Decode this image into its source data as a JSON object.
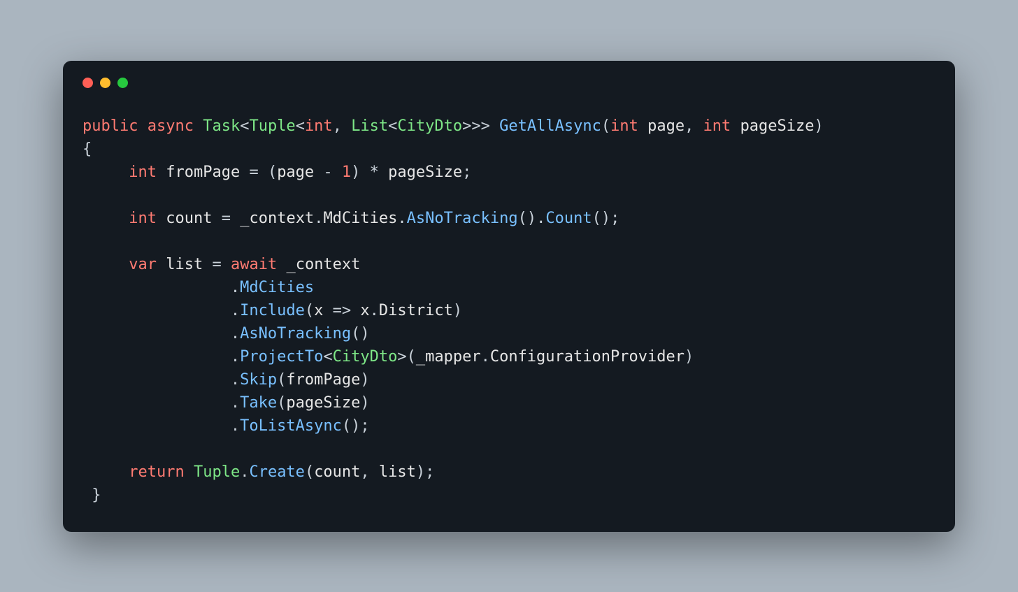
{
  "window": {
    "buttons": [
      "close",
      "minimize",
      "maximize"
    ]
  },
  "code": {
    "tokens": [
      [
        {
          "c": "kw",
          "t": "public"
        },
        {
          "c": "punct",
          "t": " "
        },
        {
          "c": "kw",
          "t": "async"
        },
        {
          "c": "punct",
          "t": " "
        },
        {
          "c": "type",
          "t": "Task"
        },
        {
          "c": "punct",
          "t": "<"
        },
        {
          "c": "type",
          "t": "Tuple"
        },
        {
          "c": "punct",
          "t": "<"
        },
        {
          "c": "kw",
          "t": "int"
        },
        {
          "c": "punct",
          "t": ", "
        },
        {
          "c": "type",
          "t": "List"
        },
        {
          "c": "punct",
          "t": "<"
        },
        {
          "c": "type",
          "t": "CityDto"
        },
        {
          "c": "punct",
          "t": ">>> "
        },
        {
          "c": "method",
          "t": "GetAllAsync"
        },
        {
          "c": "punct",
          "t": "("
        },
        {
          "c": "kw",
          "t": "int"
        },
        {
          "c": "punct",
          "t": " "
        },
        {
          "c": "ident",
          "t": "page"
        },
        {
          "c": "punct",
          "t": ", "
        },
        {
          "c": "kw",
          "t": "int"
        },
        {
          "c": "punct",
          "t": " "
        },
        {
          "c": "ident",
          "t": "pageSize"
        },
        {
          "c": "punct",
          "t": ")"
        }
      ],
      [
        {
          "c": "punct",
          "t": "{"
        }
      ],
      [
        {
          "c": "punct",
          "t": "     "
        },
        {
          "c": "kw",
          "t": "int"
        },
        {
          "c": "punct",
          "t": " "
        },
        {
          "c": "ident",
          "t": "fromPage"
        },
        {
          "c": "punct",
          "t": " = ("
        },
        {
          "c": "ident",
          "t": "page"
        },
        {
          "c": "punct",
          "t": " - "
        },
        {
          "c": "num",
          "t": "1"
        },
        {
          "c": "punct",
          "t": ") * "
        },
        {
          "c": "ident",
          "t": "pageSize"
        },
        {
          "c": "punct",
          "t": ";"
        }
      ],
      [
        {
          "c": "punct",
          "t": ""
        }
      ],
      [
        {
          "c": "punct",
          "t": "     "
        },
        {
          "c": "kw",
          "t": "int"
        },
        {
          "c": "punct",
          "t": " "
        },
        {
          "c": "ident",
          "t": "count"
        },
        {
          "c": "punct",
          "t": " = "
        },
        {
          "c": "ident",
          "t": "_context"
        },
        {
          "c": "punct",
          "t": "."
        },
        {
          "c": "ident",
          "t": "MdCities"
        },
        {
          "c": "punct",
          "t": "."
        },
        {
          "c": "method",
          "t": "AsNoTracking"
        },
        {
          "c": "punct",
          "t": "()."
        },
        {
          "c": "method",
          "t": "Count"
        },
        {
          "c": "punct",
          "t": "();"
        }
      ],
      [
        {
          "c": "punct",
          "t": ""
        }
      ],
      [
        {
          "c": "punct",
          "t": "     "
        },
        {
          "c": "kw",
          "t": "var"
        },
        {
          "c": "punct",
          "t": " "
        },
        {
          "c": "ident",
          "t": "list"
        },
        {
          "c": "punct",
          "t": " = "
        },
        {
          "c": "kw",
          "t": "await"
        },
        {
          "c": "punct",
          "t": " "
        },
        {
          "c": "ident",
          "t": "_context"
        }
      ],
      [
        {
          "c": "punct",
          "t": "                ."
        },
        {
          "c": "method",
          "t": "MdCities"
        }
      ],
      [
        {
          "c": "punct",
          "t": "                ."
        },
        {
          "c": "method",
          "t": "Include"
        },
        {
          "c": "punct",
          "t": "("
        },
        {
          "c": "ident",
          "t": "x"
        },
        {
          "c": "punct",
          "t": " => "
        },
        {
          "c": "ident",
          "t": "x"
        },
        {
          "c": "punct",
          "t": "."
        },
        {
          "c": "ident",
          "t": "District"
        },
        {
          "c": "punct",
          "t": ")"
        }
      ],
      [
        {
          "c": "punct",
          "t": "                ."
        },
        {
          "c": "method",
          "t": "AsNoTracking"
        },
        {
          "c": "punct",
          "t": "()"
        }
      ],
      [
        {
          "c": "punct",
          "t": "                ."
        },
        {
          "c": "method",
          "t": "ProjectTo"
        },
        {
          "c": "punct",
          "t": "<"
        },
        {
          "c": "type",
          "t": "CityDto"
        },
        {
          "c": "punct",
          "t": ">("
        },
        {
          "c": "ident",
          "t": "_mapper"
        },
        {
          "c": "punct",
          "t": "."
        },
        {
          "c": "ident",
          "t": "ConfigurationProvider"
        },
        {
          "c": "punct",
          "t": ")"
        }
      ],
      [
        {
          "c": "punct",
          "t": "                ."
        },
        {
          "c": "method",
          "t": "Skip"
        },
        {
          "c": "punct",
          "t": "("
        },
        {
          "c": "ident",
          "t": "fromPage"
        },
        {
          "c": "punct",
          "t": ")"
        }
      ],
      [
        {
          "c": "punct",
          "t": "                ."
        },
        {
          "c": "method",
          "t": "Take"
        },
        {
          "c": "punct",
          "t": "("
        },
        {
          "c": "ident",
          "t": "pageSize"
        },
        {
          "c": "punct",
          "t": ")"
        }
      ],
      [
        {
          "c": "punct",
          "t": "                ."
        },
        {
          "c": "method",
          "t": "ToListAsync"
        },
        {
          "c": "punct",
          "t": "();"
        }
      ],
      [
        {
          "c": "punct",
          "t": ""
        }
      ],
      [
        {
          "c": "punct",
          "t": "     "
        },
        {
          "c": "kw",
          "t": "return"
        },
        {
          "c": "punct",
          "t": " "
        },
        {
          "c": "type",
          "t": "Tuple"
        },
        {
          "c": "punct",
          "t": "."
        },
        {
          "c": "method",
          "t": "Create"
        },
        {
          "c": "punct",
          "t": "("
        },
        {
          "c": "ident",
          "t": "count"
        },
        {
          "c": "punct",
          "t": ", "
        },
        {
          "c": "ident",
          "t": "list"
        },
        {
          "c": "punct",
          "t": ");"
        }
      ],
      [
        {
          "c": "punct",
          "t": " }"
        }
      ]
    ]
  }
}
